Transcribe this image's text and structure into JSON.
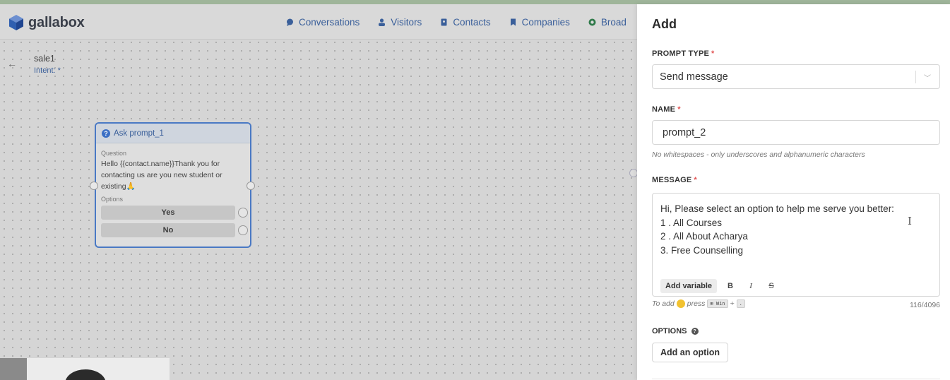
{
  "app": {
    "logo_text": "gallabox"
  },
  "nav": {
    "items": [
      {
        "label": "Conversations",
        "icon": "chat-bubble-icon"
      },
      {
        "label": "Visitors",
        "icon": "person-icon"
      },
      {
        "label": "Contacts",
        "icon": "contacts-book-icon"
      },
      {
        "label": "Companies",
        "icon": "bookmark-icon"
      },
      {
        "label": "Broad",
        "icon": "whatsapp-icon"
      }
    ]
  },
  "flow": {
    "name": "sale1",
    "intent": "Intent: *"
  },
  "node": {
    "title": "Ask prompt_1",
    "question_label": "Question",
    "question_lines": [
      "Hello {{contact.name}}Thank you for",
      "contacting us are you new student or",
      "existing🙏"
    ],
    "options_label": "Options",
    "options": [
      "Yes",
      "No"
    ]
  },
  "panel": {
    "title": "Add",
    "prompt_type_label": "PROMPT TYPE",
    "prompt_type_value": "Send message",
    "name_label": "NAME",
    "name_value": "prompt_2",
    "name_hint": "No whitespaces - only underscores and alphanumeric characters",
    "message_label": "MESSAGE",
    "message_lines": [
      "Hi, Please select an option to help me serve you better:",
      "1 . All Courses",
      "2 . All About Acharya",
      "3. Free Counselling"
    ],
    "add_variable": "Add variable",
    "bold": "B",
    "italic": "I",
    "strike": "S",
    "emoji_hint_prefix": "To add",
    "emoji_hint_press": "press",
    "emoji_key1": "⊞ Win",
    "emoji_plus": "+",
    "emoji_key2": ".",
    "counter": "116/4096",
    "options_label": "OPTIONS",
    "add_option": "Add an option",
    "required_mark": "*"
  }
}
